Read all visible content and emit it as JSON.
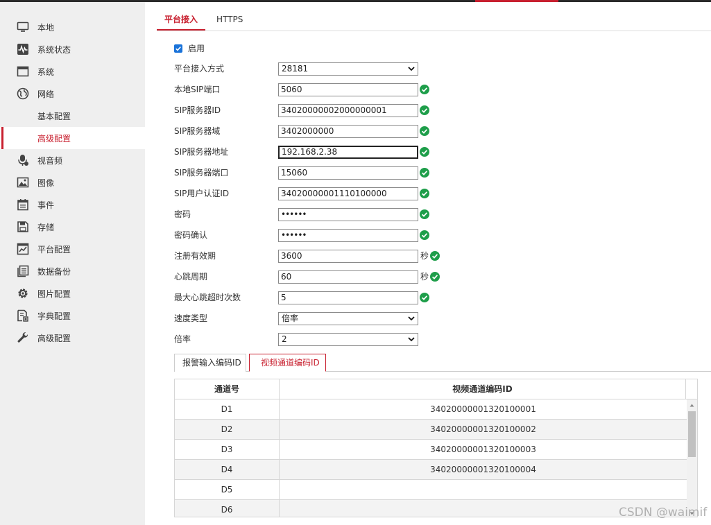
{
  "sidebar": {
    "items": [
      {
        "label": "本地",
        "icon": "monitor-icon"
      },
      {
        "label": "系统状态",
        "icon": "pulse-icon"
      },
      {
        "label": "系统",
        "icon": "window-icon"
      },
      {
        "label": "网络",
        "icon": "globe-icon"
      },
      {
        "label": "视音频",
        "icon": "microphone-icon"
      },
      {
        "label": "图像",
        "icon": "image-icon"
      },
      {
        "label": "事件",
        "icon": "calendar-icon"
      },
      {
        "label": "存储",
        "icon": "floppy-icon"
      },
      {
        "label": "平台配置",
        "icon": "chart-icon"
      },
      {
        "label": "数据备份",
        "icon": "copy-icon"
      },
      {
        "label": "图片配置",
        "icon": "gear-icon"
      },
      {
        "label": "字典配置",
        "icon": "dictionary-icon"
      },
      {
        "label": "高级配置",
        "icon": "wrench-icon"
      }
    ],
    "network_sub": [
      "基本配置",
      "高级配置"
    ],
    "active_sub": "高级配置"
  },
  "tabs": [
    "平台接入",
    "HTTPS"
  ],
  "active_tab": "平台接入",
  "form": {
    "enable_label": "启用",
    "enabled": true,
    "access_mode_label": "平台接入方式",
    "access_mode_value": "28181",
    "local_sip_port_label": "本地SIP端口",
    "local_sip_port": "5060",
    "sip_server_id_label": "SIP服务器ID",
    "sip_server_id": "34020000002000000001",
    "sip_server_domain_label": "SIP服务器域",
    "sip_server_domain": "3402000000",
    "sip_server_addr_label": "SIP服务器地址",
    "sip_server_addr": "192.168.2.38",
    "sip_server_port_label": "SIP服务器端口",
    "sip_server_port": "15060",
    "sip_user_auth_id_label": "SIP用户认证ID",
    "sip_user_auth_id": "34020000001110100000",
    "password_label": "密码",
    "password": "••••••",
    "password_confirm_label": "密码确认",
    "password_confirm": "••••••",
    "register_validity_label": "注册有效期",
    "register_validity": "3600",
    "heartbeat_period_label": "心跳周期",
    "heartbeat_period": "60",
    "seconds_unit": "秒",
    "max_heartbeat_timeout_label": "最大心跳超时次数",
    "max_heartbeat_timeout": "5",
    "speed_type_label": "速度类型",
    "speed_type_value": "倍率",
    "rate_label": "倍率",
    "rate_value": "2"
  },
  "subtabs": [
    "报警输入编码ID",
    "视频通道编码ID"
  ],
  "active_subtab": "视频通道编码ID",
  "channel_table": {
    "headers": [
      "通道号",
      "视频通道编码ID"
    ],
    "rows": [
      [
        "D1",
        "34020000001320100001"
      ],
      [
        "D2",
        "34020000001320100002"
      ],
      [
        "D3",
        "34020000001320100003"
      ],
      [
        "D4",
        "34020000001320100004"
      ],
      [
        "D5",
        ""
      ],
      [
        "D6",
        ""
      ]
    ]
  },
  "watermark": "CSDN @waimif",
  "colors": {
    "accent": "#c8202f",
    "check_blue": "#1a73d9",
    "ok_green": "#1e9e4a",
    "sidebar_bg": "#efefef"
  }
}
